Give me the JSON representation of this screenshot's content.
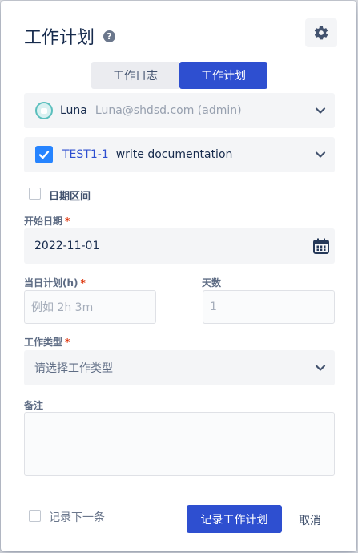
{
  "dialog": {
    "title": "工作计划",
    "help_glyph": "?",
    "icons": {
      "help": "question-circle-icon",
      "settings": "gear-icon"
    }
  },
  "tabs": [
    {
      "label": "工作日志",
      "active": false
    },
    {
      "label": "工作计划",
      "active": true
    }
  ],
  "user": {
    "name": "Luna",
    "email": "Luna@shdsd.com (admin)",
    "avatar_icon": "robot-avatar-icon"
  },
  "issue": {
    "key": "TEST1-1",
    "summary": "write documentation",
    "checked": true
  },
  "date_range": {
    "label": "日期区间",
    "checked": false
  },
  "start_date": {
    "label": "开始日期",
    "required_mark": "*",
    "value": "2022-11-01",
    "icon": "calendar-icon"
  },
  "daily_plan": {
    "label": "当日计划(h)",
    "required_mark": "*",
    "placeholder": "例如 2h 3m"
  },
  "days": {
    "label": "天数",
    "value": "1"
  },
  "work_type": {
    "label": "工作类型",
    "required_mark": "*",
    "placeholder": "请选择工作类型"
  },
  "notes": {
    "label": "备注",
    "value": ""
  },
  "footer": {
    "record_next_label": "记录下一条",
    "record_next_checked": false,
    "submit_label": "记录工作计划",
    "cancel_label": "取消"
  },
  "colors": {
    "accent": "#2e4fd0",
    "checkbox_blue": "#2684ff",
    "required": "#de350b"
  }
}
